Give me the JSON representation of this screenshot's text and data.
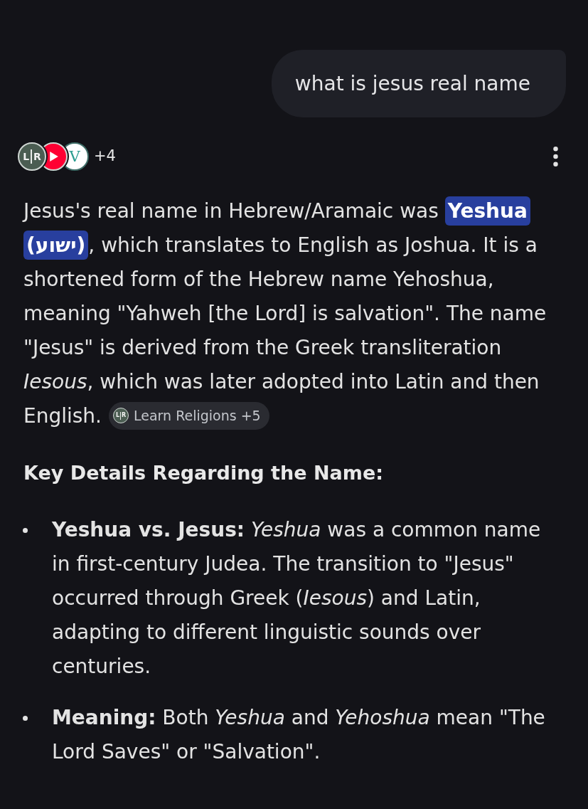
{
  "user_message": {
    "text": "what is jesus real name"
  },
  "sources": {
    "logos": [
      {
        "kind": "monogram",
        "letters": [
          "L",
          "R"
        ]
      },
      {
        "kind": "play"
      },
      {
        "kind": "letter",
        "letters": [
          "V"
        ]
      }
    ],
    "more_count": "+4"
  },
  "answer": {
    "segments": [
      {
        "text": "Jesus's real name in Hebrew/Aramaic was ",
        "highlighted": false
      },
      {
        "text": "Yeshua (ישוע)",
        "highlighted": true
      },
      {
        "text": ", which translates to English as Joshua. It is a shortened form of the Hebrew name Yehoshua, meaning \"Yahweh [the Lord] is salvation\". The name \"Jesus\" is derived from the Greek transliteration *Iesous*, which was later adopted into Latin and then English.",
        "highlighted": false
      }
    ],
    "citation": {
      "logo": {
        "kind": "monogram",
        "letters": [
          "L",
          "R"
        ]
      },
      "label": "Learn Religions +5"
    }
  },
  "heading": "Key Details Regarding the Name:",
  "bullets": [
    "**Yeshua vs. Jesus:** *Yeshua* was a common name in first-century Judea. The transition to \"Jesus\" occurred through Greek (*Iesous*) and Latin, adapting to different linguistic sounds over centuries.",
    "**Meaning:** Both *Yeshua* and *Yehoshua* mean \"The Lord Saves\" or \"Salvation\"."
  ]
}
